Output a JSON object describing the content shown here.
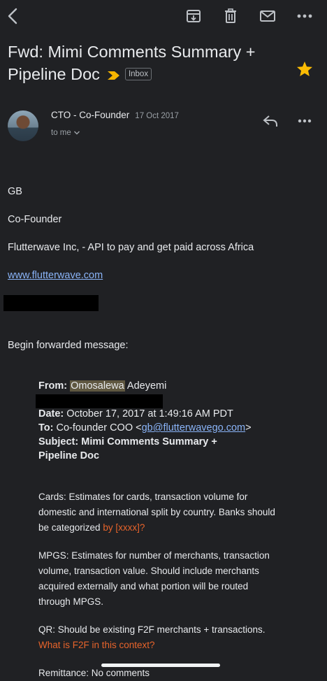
{
  "toolbar": {
    "back_icon": "back-arrow-icon",
    "archive_icon": "archive-icon",
    "delete_icon": "trash-icon",
    "mark_unread_icon": "envelope-icon",
    "more_icon": "more-horizontal-icon"
  },
  "email": {
    "subject": "Fwd: Mimi Comments Summary + Pipeline Doc",
    "label": "Inbox",
    "starred": true,
    "sender": "CTO - Co-Founder",
    "date": "17 Oct 2017",
    "recipient": "to me"
  },
  "body": {
    "sig_name": "GB",
    "sig_title": "Co-Founder",
    "sig_company": "Flutterwave Inc, - API to pay and get paid across Africa",
    "sig_link": "www.flutterwave.com",
    "begin_forwarded": "Begin forwarded message:"
  },
  "forwarded": {
    "from_label": "From:",
    "from_first": "Omosalewa",
    "from_last": "Adeyemi",
    "date_label": "Date:",
    "date_value": "October 17, 2017 at 1:49:16 AM PDT",
    "to_label": "To:",
    "to_name": "Co-founder COO <",
    "to_email": "gb@flutterwavego.com",
    "to_close": ">",
    "subject_label": "Subject:",
    "subject_line1": "Mimi Comments Summary +",
    "subject_line2": "Pipeline Doc",
    "para1": "Cards: Estimates for cards, transaction volume for domestic and international split by country. Banks should be categorized ",
    "para1_comment": "by [xxxx]?",
    "para2": "MPGS: Estimates for number of merchants, transaction volume, transaction value. Should include merchants acquired externally and what portion will be routed through MPGS.",
    "para3": "QR: Should be existing F2F merchants + transactions. ",
    "para3_comment": "What is F2F in this context?",
    "para4": "Remittance: No comments"
  },
  "colors": {
    "background": "#202124",
    "star": "#fbbc04",
    "importance": "#f5b400",
    "link": "#8ab4f8",
    "comment": "#e8642b"
  }
}
